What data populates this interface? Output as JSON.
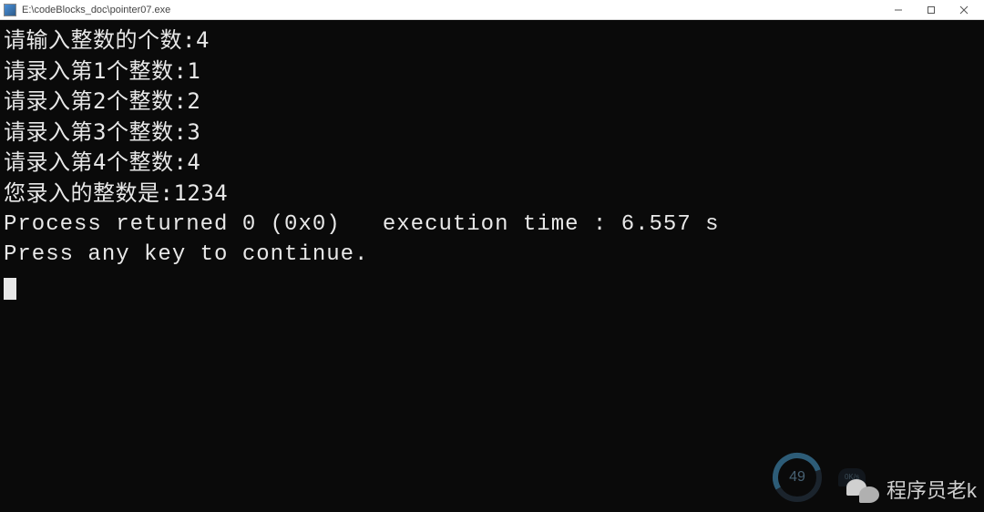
{
  "window": {
    "title": "E:\\codeBlocks_doc\\pointer07.exe"
  },
  "console": {
    "lines": [
      "请输入整数的个数:4",
      "请录入第1个整数:1",
      "请录入第2个整数:2",
      "请录入第3个整数:3",
      "请录入第4个整数:4",
      "您录入的整数是:1234"
    ],
    "process_line": "Process returned 0 (0x0)   execution time : 6.557 s",
    "press_line": "Press any key to continue."
  },
  "gauge": {
    "value": "49",
    "small": "0K/s"
  },
  "watermark": {
    "text": "程序员老k"
  }
}
